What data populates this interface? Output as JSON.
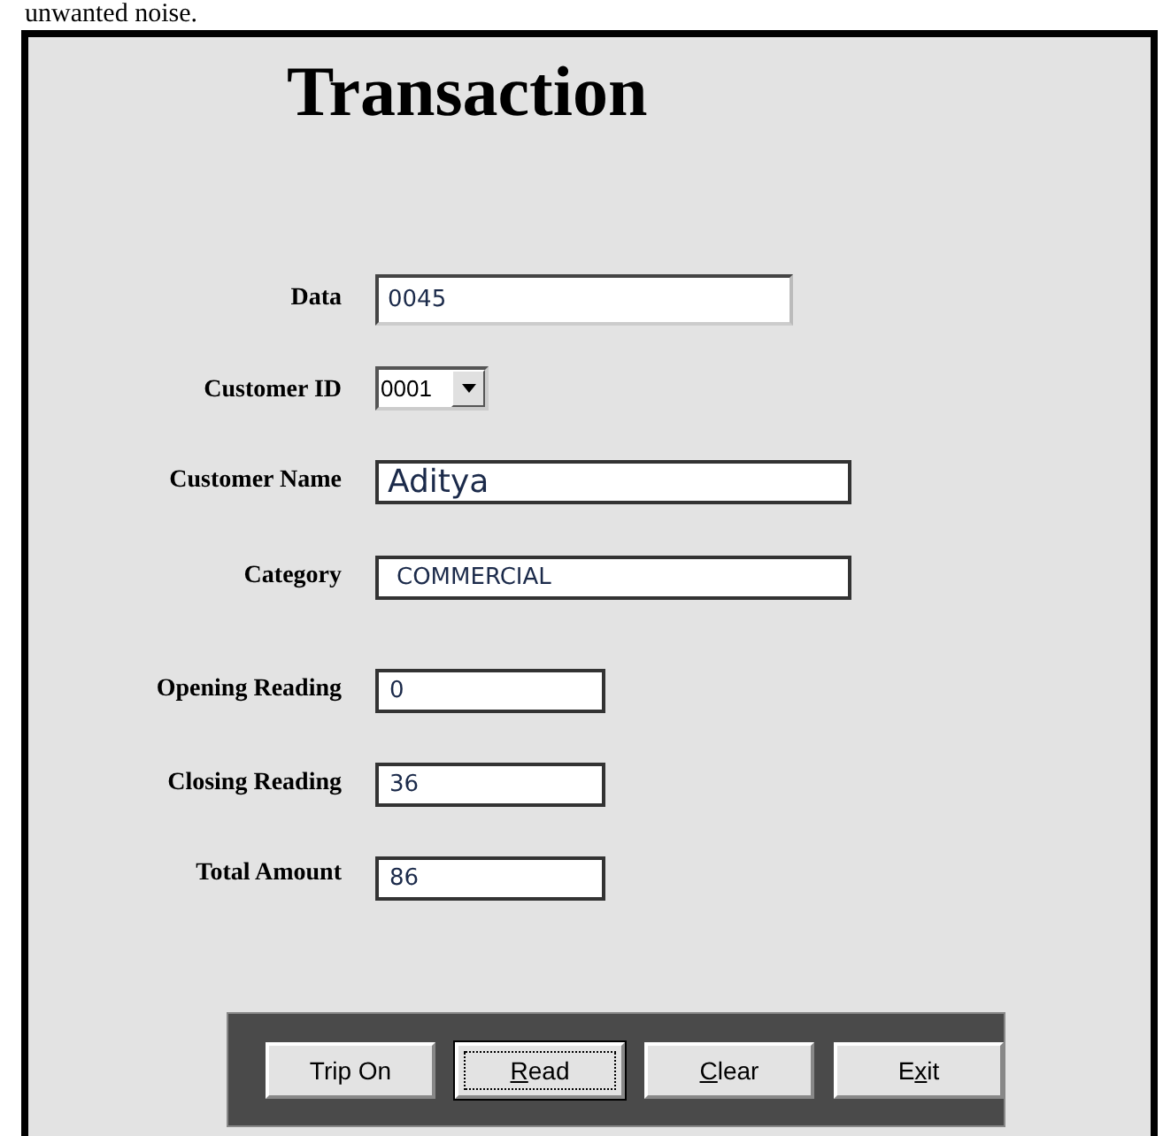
{
  "caption_fragment": "unwanted noise.",
  "form": {
    "title": "Transaction",
    "fields": [
      {
        "label": "Data",
        "kind": "text",
        "value": "0045"
      },
      {
        "label": "Customer ID",
        "kind": "dropdown",
        "value": "0001"
      },
      {
        "label": "Customer Name",
        "kind": "text",
        "value": "Aditya"
      },
      {
        "label": "Category",
        "kind": "text",
        "value": "COMMERCIAL"
      },
      {
        "label": "Opening Reading",
        "kind": "short",
        "value": "0"
      },
      {
        "label": "Closing Reading",
        "kind": "short",
        "value": "36"
      },
      {
        "label": "Total Amount",
        "kind": "short",
        "value": "86"
      }
    ],
    "buttons": [
      {
        "label": "Trip On",
        "focused": false
      },
      {
        "underlined": "R",
        "label_end": "ead",
        "focused": true
      },
      {
        "underlined": "C",
        "label_end": "lear",
        "focused": false
      },
      {
        "label_start": "E",
        "underlined": "x",
        "label_end": "it",
        "focused": false
      }
    ]
  }
}
